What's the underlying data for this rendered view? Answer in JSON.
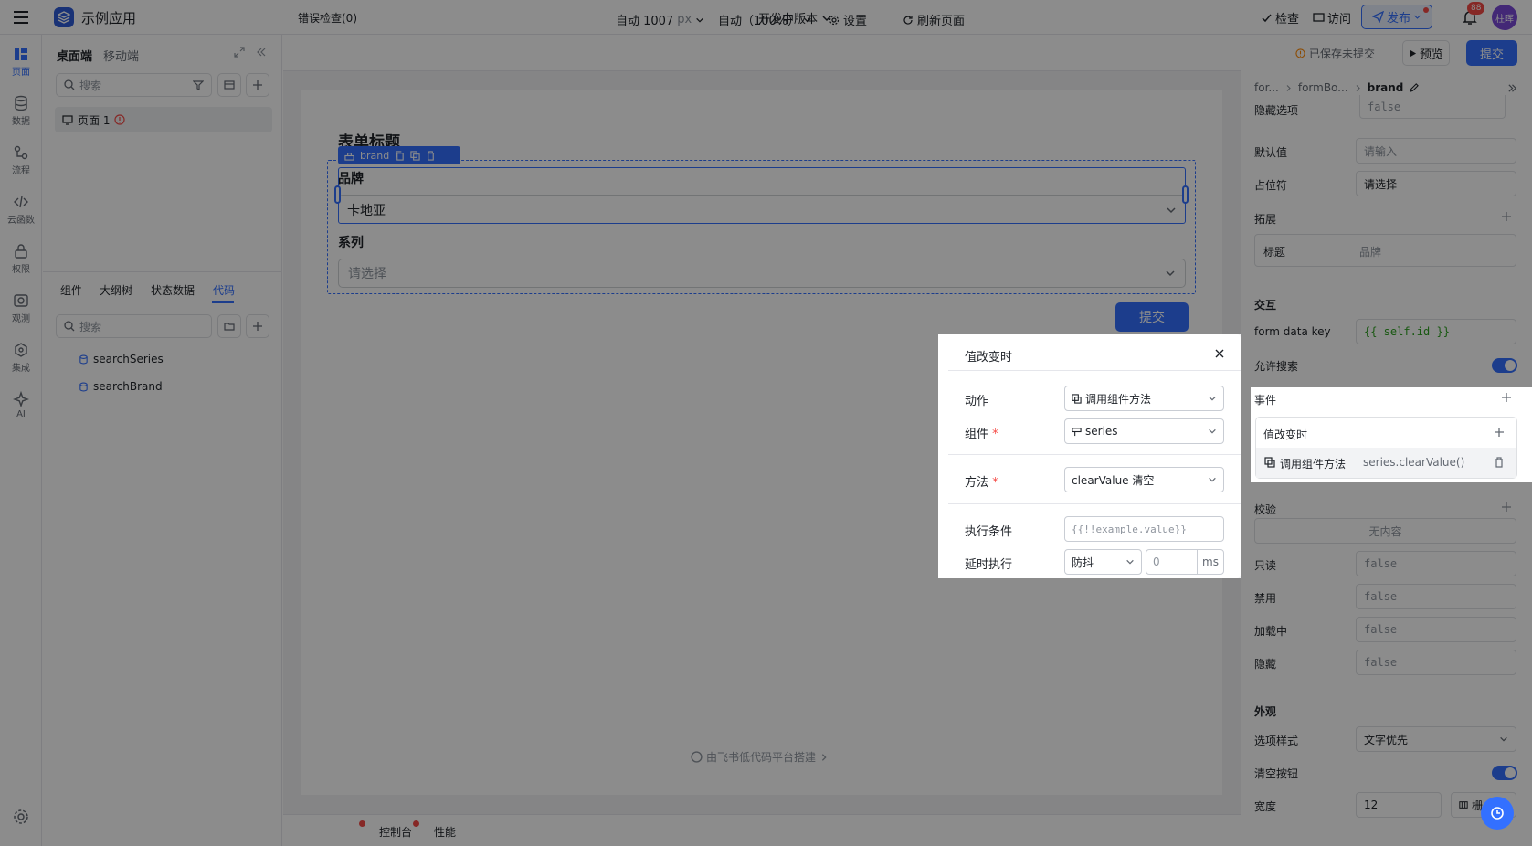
{
  "app": {
    "title": "示例应用",
    "version": "开发中版本",
    "check": "检查",
    "visit": "访问",
    "publish": "发布",
    "notifications": "88",
    "avatar": "柱晖"
  },
  "rail": {
    "items": [
      {
        "label": "页面",
        "icon": "layout-icon"
      },
      {
        "label": "数据",
        "icon": "database-icon"
      },
      {
        "label": "流程",
        "icon": "flow-icon"
      },
      {
        "label": "云函数",
        "icon": "code-icon"
      },
      {
        "label": "权限",
        "icon": "lock-icon"
      },
      {
        "label": "观测",
        "icon": "monitor-icon"
      },
      {
        "label": "集成",
        "icon": "integration-icon"
      },
      {
        "label": "AI",
        "icon": "ai-sparkle-icon"
      }
    ]
  },
  "left_panel": {
    "tabs_top": [
      "桌面端",
      "移动端"
    ],
    "search_placeholder": "搜索",
    "page_item": "页面 1",
    "tabs_bottom": [
      "组件",
      "大纲树",
      "状态数据",
      "代码"
    ],
    "search2_placeholder": "搜索",
    "code_items": [
      "searchSeries",
      "searchBrand"
    ]
  },
  "canvas_toolbar": {
    "width": "自动 1007",
    "width_unit": "px",
    "zoom": "自动（100%）",
    "settings": "设置",
    "refresh": "刷新页面"
  },
  "form": {
    "title": "表单标题",
    "tag": "brand",
    "brand_label": "品牌",
    "brand_value": "卡地亚",
    "series_label": "系列",
    "series_placeholder": "请选择",
    "submit": "提交",
    "footer": "由飞书低代码平台搭建"
  },
  "bottom_bar": {
    "errors": "错误检查(0)",
    "console": "控制台",
    "performance": "性能"
  },
  "right_panel": {
    "saved": "已保存未提交",
    "preview": "预览",
    "submit": "提交",
    "breadcrumb": [
      "for...",
      "formBo...",
      "brand"
    ],
    "hidden_option_label": "隐藏选项",
    "hidden_option_value": "false",
    "default_label": "默认值",
    "default_placeholder": "请输入",
    "placeholder_label": "占位符",
    "placeholder_value": "请选择",
    "extend_label": "拓展",
    "ext_title_label": "标题",
    "ext_title_value": "品牌",
    "interaction": "交互",
    "form_key_label": "form data key",
    "form_key_value": "{{ self.id }}",
    "allow_search": "允许搜索",
    "events": "事件",
    "event_name": "值改变时",
    "event_action": "调用组件方法",
    "event_target": "series.clearValue()",
    "validation": "校验",
    "no_content": "无内容",
    "readonly_label": "只读",
    "readonly_value": "false",
    "disabled_label": "禁用",
    "disabled_value": "false",
    "loading_label": "加载中",
    "loading_value": "false",
    "hide_label": "隐藏",
    "hide_value": "false",
    "appearance": "外观",
    "option_style_label": "选项样式",
    "option_style_value": "文字优先",
    "clear_btn_label": "清空按钮",
    "width_label": "宽度",
    "width_value": "12",
    "width_unit": "栅"
  },
  "dialog": {
    "title": "值改变时",
    "action_label": "动作",
    "action_value": "调用组件方法",
    "component_label": "组件",
    "component_value": "series",
    "method_label": "方法",
    "method_value": "clearValue 清空",
    "condition_label": "执行条件",
    "condition_placeholder": "{{!!example.value}}",
    "delay_label": "延时执行",
    "delay_mode": "防抖",
    "delay_value": "0",
    "delay_unit": "ms"
  }
}
